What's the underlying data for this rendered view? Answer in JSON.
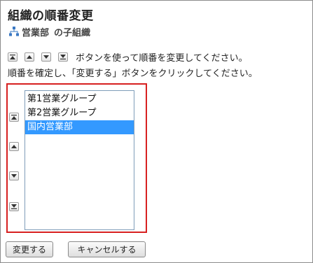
{
  "page": {
    "title": "組織の順番変更",
    "org_name": "営業部",
    "org_suffix": "の子組織"
  },
  "instructions": {
    "line1": "ボタンを使って順番を変更してください。",
    "line2": "順番を確定し、「変更する」ボタンをクリックしてください。"
  },
  "order_list": {
    "items": [
      "第1営業グループ",
      "第2営業グループ",
      "国内営業部"
    ],
    "selected_index": 2
  },
  "actions": {
    "submit_label": "変更する",
    "cancel_label": "キャンセルする"
  },
  "colors": {
    "highlight_box": "#d72020",
    "selection": "#3399ff",
    "org_icon": "#3a78c3"
  },
  "icons": [
    "org-tree-icon",
    "move-to-top-icon",
    "move-up-icon",
    "move-down-icon",
    "move-to-bottom-icon"
  ]
}
